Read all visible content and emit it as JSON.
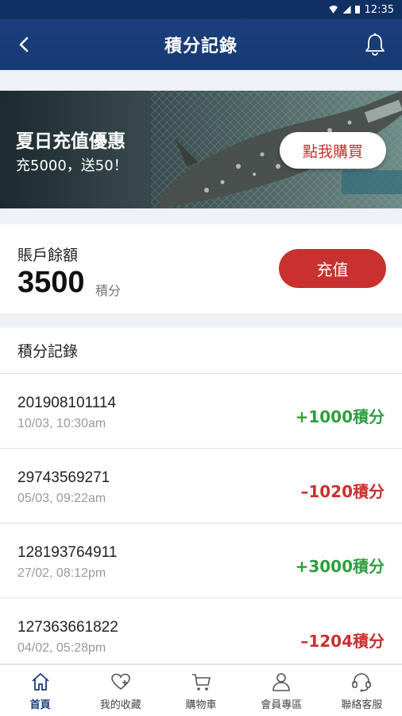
{
  "status_bar": {
    "time": "12:35"
  },
  "header": {
    "title": "積分記錄",
    "back_icon": "chevron-left-icon",
    "bell_icon": "bell-icon"
  },
  "banner": {
    "title": "夏日充值優惠",
    "subtitle": "充5000，送50！",
    "button": "點我購買"
  },
  "balance": {
    "label": "賬戶餘額",
    "value": "3500",
    "unit": "積分",
    "recharge_button": "充值"
  },
  "records": {
    "title": "積分記錄",
    "items": [
      {
        "id": "201908101114",
        "time": "10/03, 10:30am",
        "amount": "+1000積分",
        "type": "credit"
      },
      {
        "id": "29743569271",
        "time": "05/03, 09:22am",
        "amount": "–1020積分",
        "type": "debit"
      },
      {
        "id": "128193764911",
        "time": "27/02, 08:12pm",
        "amount": "+3000積分",
        "type": "credit"
      },
      {
        "id": "127363661822",
        "time": "04/02, 05:28pm",
        "amount": "–1204積分",
        "type": "debit"
      }
    ]
  },
  "tabs": [
    {
      "label": "首頁",
      "icon": "home-icon",
      "active": true
    },
    {
      "label": "我的收藏",
      "icon": "heart-plus-icon",
      "active": false
    },
    {
      "label": "購物車",
      "icon": "cart-icon",
      "active": false
    },
    {
      "label": "會員專區",
      "icon": "user-icon",
      "active": false
    },
    {
      "label": "聯絡客服",
      "icon": "headset-icon",
      "active": false
    }
  ],
  "colors": {
    "primary": "#1a3d78",
    "accent_red": "#c8312f",
    "credit_green": "#2f9e3f"
  }
}
